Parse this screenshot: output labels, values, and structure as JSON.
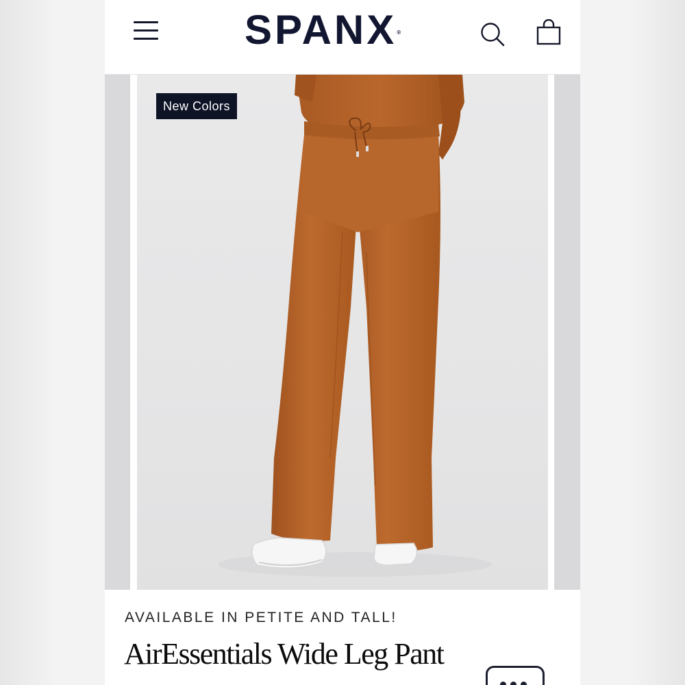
{
  "header": {
    "brand": "SPANX",
    "brand_mark": "®",
    "menu_icon": "hamburger-menu-icon",
    "search_icon": "search-icon",
    "cart_icon": "shopping-bag-icon"
  },
  "carousel": {
    "badge": "New Colors",
    "product_color": "#b5642b"
  },
  "product": {
    "availability": "AVAILABLE IN PETITE AND TALL!",
    "title": "AirEssentials Wide Leg Pant"
  },
  "chat": {
    "icon": "chat-bubble-icon"
  },
  "colors": {
    "brand_navy": "#121631",
    "badge_bg": "#0f1326"
  }
}
